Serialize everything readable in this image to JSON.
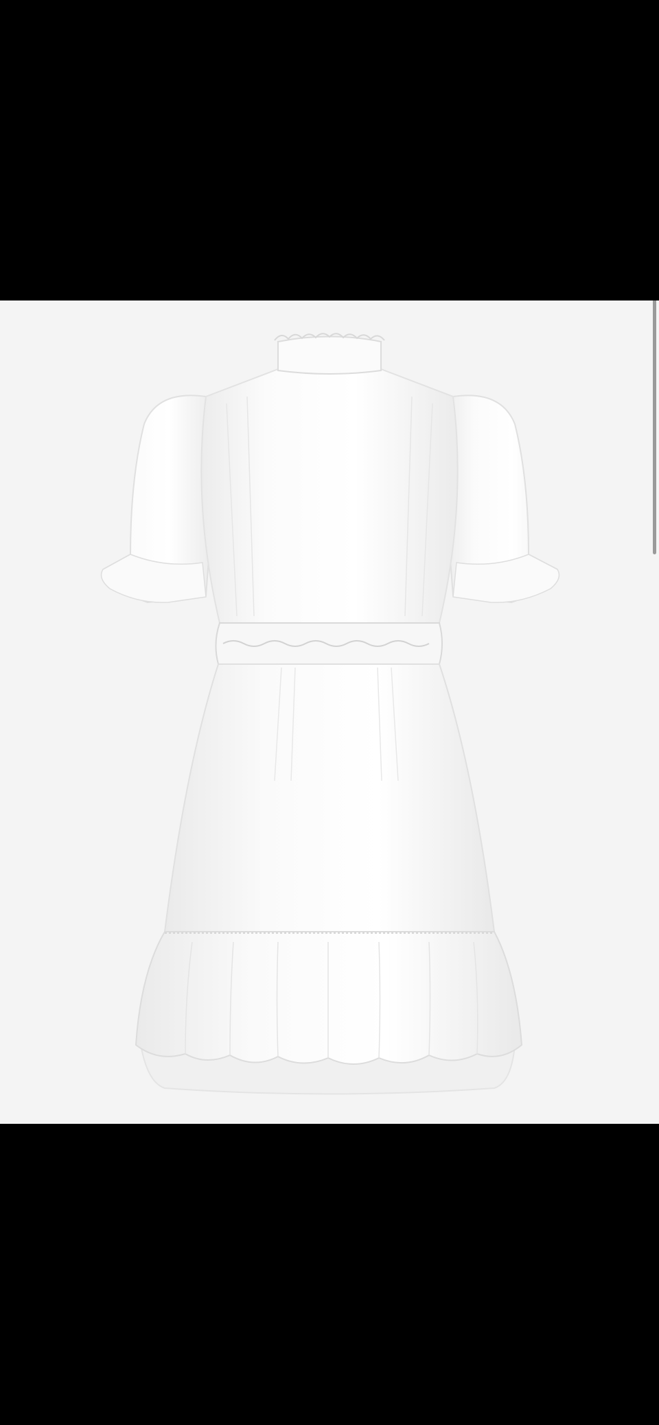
{
  "viewer": {
    "background_color": "#000000",
    "photo_background_color": "#f4f4f4",
    "scrollbar_color": "#9a9a9a"
  },
  "image": {
    "subject_icon": "dress-icon",
    "garment_color": "#ffffff",
    "shadow_color": "#e2e2e2"
  }
}
